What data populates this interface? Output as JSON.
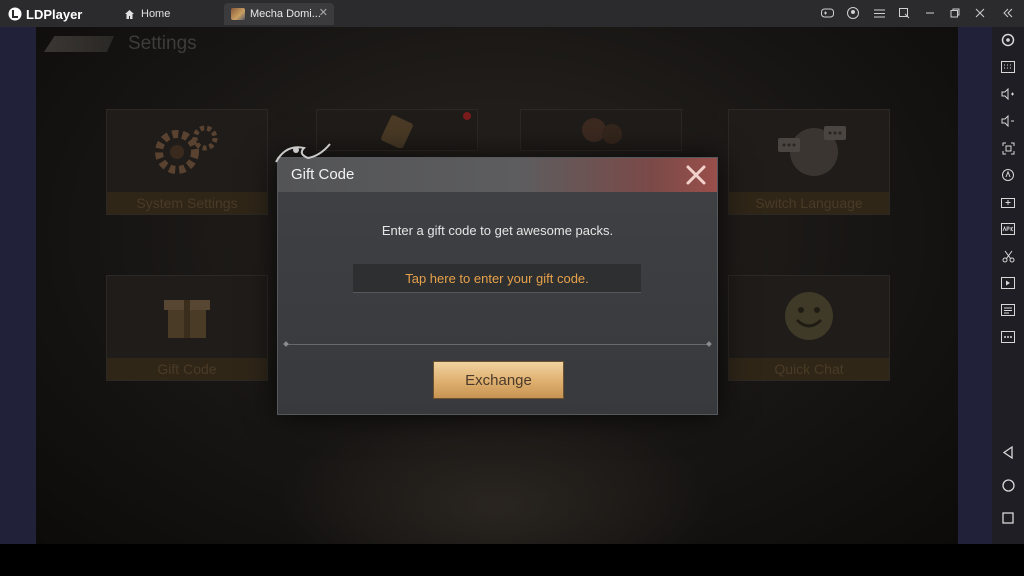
{
  "app": {
    "brand": "LDPlayer",
    "tabs": [
      {
        "label": "Home",
        "icon": "home-icon"
      },
      {
        "label": "Mecha Domi...",
        "icon": "game-icon"
      }
    ],
    "window_controls": [
      "gamepad-icon",
      "account-icon",
      "menu-icon",
      "multi-instance-icon",
      "minimize-icon",
      "restore-icon",
      "close-icon",
      "collapse-sidebar-icon"
    ]
  },
  "sidebar": {
    "top_icons": [
      "settings-icon",
      "keyboard-icon",
      "volume-up-icon",
      "volume-down-icon",
      "screenshot-icon",
      "rotate-icon",
      "install-apk-icon",
      "apk-icon",
      "scissors-icon",
      "video-icon",
      "shared-folder-icon",
      "more-icon"
    ],
    "bottom_icons": [
      "back-icon",
      "home-circle-icon",
      "recents-icon"
    ]
  },
  "game": {
    "screen_title": "Settings",
    "tiles": [
      {
        "label": "System Settings",
        "icon": "gears-icon"
      },
      {
        "label": "",
        "icon": "tag-icon"
      },
      {
        "label": "",
        "icon": "characters-icon"
      },
      {
        "label": "Switch Language",
        "icon": "globe-chat-icon"
      },
      {
        "label": "Gift Code",
        "icon": "gift-box-icon"
      },
      {
        "label": "Quick Chat",
        "icon": "smiley-icon"
      }
    ]
  },
  "dialog": {
    "title": "Gift Code",
    "prompt": "Enter a gift code to get awesome packs.",
    "input_placeholder": "Tap here to enter your gift code.",
    "exchange_label": "Exchange"
  }
}
